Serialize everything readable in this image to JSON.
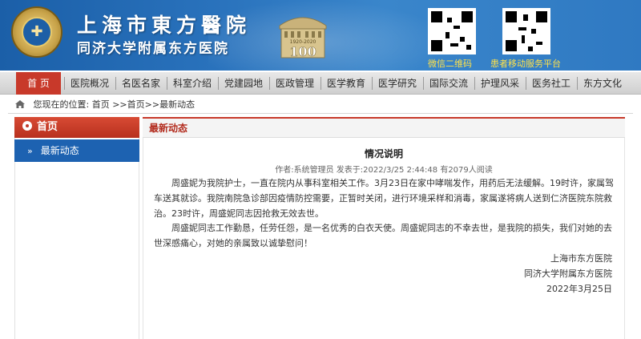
{
  "header": {
    "title_cn": "上海市東方醫院",
    "subtitle": "同济大学附属东方医院",
    "centennial_years": "1920-2020",
    "centennial_number": "100",
    "qr_labels": [
      "微信二维码",
      "患者移动服务平台"
    ]
  },
  "nav": {
    "items": [
      "首 页",
      "医院概况",
      "名医名家",
      "科室介绍",
      "党建园地",
      "医政管理",
      "医学教育",
      "医学研究",
      "国际交流",
      "护理风采",
      "医务社工",
      "东方文化"
    ],
    "active_index": 0
  },
  "breadcrumb": {
    "prefix": "您现在的位置:",
    "path": "首页 >>首页>>最新动态"
  },
  "sidebar": {
    "heading": "首页",
    "items": [
      {
        "label": "最新动态",
        "arrow": "»"
      }
    ]
  },
  "content": {
    "section_title": "最新动态",
    "article": {
      "title": "情况说明",
      "meta": "作者:系统管理员 发表于:2022/3/25 2:44:48 有2079人阅读",
      "paragraphs": [
        "周盛妮为我院护士，一直在院内从事科室相关工作。3月23日在家中哮喘发作，用药后无法缓解。19时许，家属驾车送其就诊。我院南院急诊部因疫情防控需要，正暂时关闭，进行环境采样和消毒，家属遂将病人送到仁济医院东院救治。23时许，周盛妮同志因抢救无效去世。",
        "周盛妮同志工作勤恳，任劳任怨，是一名优秀的白衣天使。周盛妮同志的不幸去世，是我院的损失，我们对她的去世深感痛心，对她的亲属致以诚挚慰问！"
      ],
      "signature": [
        "上海市东方医院",
        "同济大学附属东方医院",
        "2022年3月25日"
      ]
    }
  },
  "colors": {
    "header_blue": "#2a73bd",
    "nav_active": "#c8392a",
    "sidebar_active": "#1d62b1",
    "qr_label": "#ffe14a"
  }
}
